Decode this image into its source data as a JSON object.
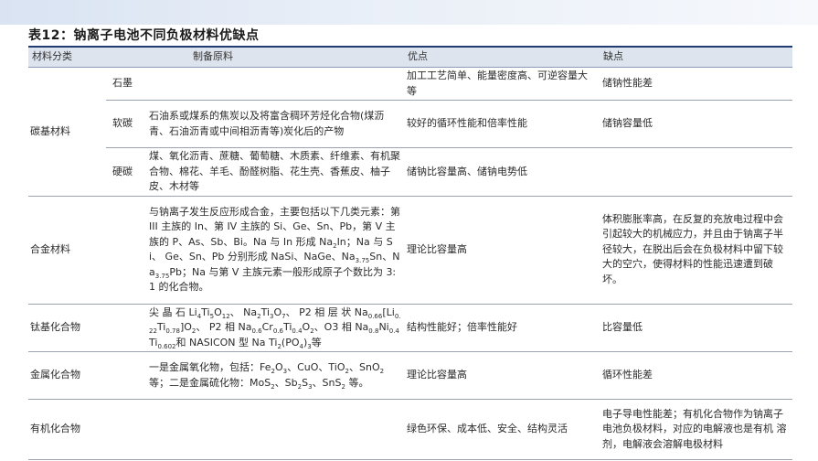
{
  "title": "表12：钠离子电池不同负极材料优缺点",
  "table": {
    "headers": [
      "材料分类",
      "制备原料",
      "优点",
      "缺点"
    ],
    "rows": [
      {
        "category": "碳基材料",
        "sub": [
          {
            "name": "石墨",
            "raw": "",
            "pros": "加工工艺简单、能量密度高、可逆容量大等",
            "cons": "储钠性能差"
          },
          {
            "name": "软碳",
            "raw": "石油系或煤系的焦炭以及将富含稠环芳烃化合物(煤沥青、石油沥青或中间相沥青等)炭化后的产物",
            "pros": "较好的循环性能和倍率性能",
            "cons": "储钠容量低"
          },
          {
            "name": "硬碳",
            "raw": "煤、氧化沥青、蔗糖、葡萄糖、木质素、纤维素、有机聚合物、棉花、羊毛、酚醛树脂、花生壳、香蕉皮、柚子皮、木材等",
            "pros": "储钠比容量高、储钠电势低",
            "cons": ""
          }
        ]
      },
      {
        "category": "合金材料",
        "raw_parts": [
          "与钠离子发生反应形成合金，主要包括以下几类元素：第 III 主族的 In、第 IV 主族的 Si、Ge、Sn、Pb，第 V 主族的 P、As、Sb、Bi。Na 与 In 形成 Na",
          "2",
          "In；Na 与 Si、 Ge、Sn、Pb 分别形成 NaSi、NaGe、Na",
          "3.75",
          "Sn、Na",
          "3.75",
          "Pb；Na 与第 V 主族元素一般形成原子个数比为 3:1 的化合物。"
        ],
        "pros": "理论比容量高",
        "cons": "体积膨胀率高，在反复的充放电过程中会引起较大的机械应力，并且由于钠离子半径较大，在脱出后会在负极材料中留下较大的空穴，使得材料的性能迅速遭到破坏。"
      },
      {
        "category": "钛基化合物",
        "raw_parts": [
          "尖 晶 石 Li",
          "4",
          "Ti",
          "5",
          "O",
          "12",
          "、 Na",
          "2",
          "Ti",
          "3",
          "O",
          "7",
          "、 P2 相 层 状 Na",
          "0.66",
          "[Li",
          "0.22",
          "Ti",
          "0.78",
          "]O",
          "2",
          "、 P2 相 Na",
          "0.6",
          "Cr",
          "0.6",
          "Ti",
          "0.4",
          "O",
          "2",
          "、O3 相 Na",
          "0.8",
          "Ni",
          "0.4",
          "Ti",
          "0.602",
          "和 NASICON 型 Na Ti",
          "2",
          "(PO",
          "4",
          ")",
          "3",
          "等"
        ],
        "pros": "结构性能好；倍率性能好",
        "cons": "比容量低"
      },
      {
        "category": "金属化合物",
        "raw_parts": [
          "一是金属氧化物，包括：Fe",
          "2",
          "O",
          "3",
          "、CuO、TiO",
          "2",
          "、SnO",
          "2",
          " 等；二是金属硫化物：MoS",
          "2",
          "、Sb",
          "2",
          "S",
          "3",
          "、SnS",
          "2",
          " 等。"
        ],
        "pros": "理论比容量高",
        "cons": "循环性能差"
      },
      {
        "category": "有机化合物",
        "raw_parts": [
          ""
        ],
        "pros": "绿色环保、成本低、安全、结构灵活",
        "cons": "电子导电性能差；有机化合物作为钠离子电池负极材料，对应的电解液也是有机 溶剂，电解液会溶解电极材料"
      }
    ]
  }
}
